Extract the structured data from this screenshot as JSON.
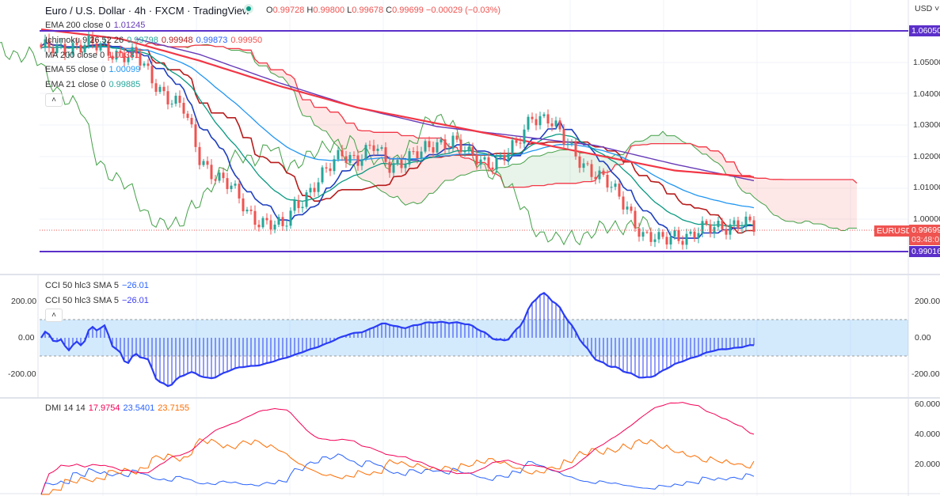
{
  "header": {
    "title": "Euro / U.S. Dollar · 4h · FXCM · TradingView",
    "open_label": "O",
    "open": "0.99728",
    "high_label": "H",
    "high": "0.99800",
    "low_label": "L",
    "low": "0.99678",
    "close_label": "C",
    "close": "0.99699",
    "change": "−0.00029 (−0.03%)",
    "currency": "USD"
  },
  "indicators": {
    "ema200": {
      "name": "EMA 200 close 0",
      "value": "1.01245",
      "color": "#673ab7"
    },
    "ichimoku": {
      "name": "Ichimoku 9 26 52 26",
      "v1": "0.99798",
      "v2": "0.99948",
      "v3": "0.99873",
      "v4": "0.99950"
    },
    "ma200": {
      "name": "MA 200 close 0",
      "value": "1.01381",
      "color": "#f23645"
    },
    "ema55": {
      "name": "EMA 55 close 0",
      "value": "1.00099",
      "color": "#2196f3"
    },
    "ema21": {
      "name": "EMA 21 close 0",
      "value": "0.99885",
      "color": "#26a69a"
    }
  },
  "price_axis": {
    "ticks": [
      "1.05000",
      "1.04000",
      "1.03000",
      "1.02000",
      "1.01000",
      "1.00000"
    ],
    "top_line": "1.06050",
    "bottom_line": "0.99016",
    "last_price": "0.99699",
    "countdown": "03:48:0",
    "symbol_tag": "EURUSD"
  },
  "cci": {
    "legend1": {
      "name": "CCI 50 hlc3 SMA 5",
      "value": "−26.01"
    },
    "legend2": {
      "name": "CCI 50 hlc3 SMA 5",
      "value": "−26.01"
    },
    "ticks": [
      "200.00",
      "0.00",
      "-200.00"
    ]
  },
  "dmi": {
    "name": "DMI 14 14",
    "adx": "17.9754",
    "plus_di": "23.5401",
    "minus_di": "23.7155",
    "ticks": [
      "60.0000",
      "40.0000",
      "20.0000"
    ]
  },
  "colors": {
    "up": "#26a69a",
    "down": "#ef5350",
    "level_line": "#5b2fc9",
    "accent_red": "#ef5350"
  },
  "chart_data": {
    "type": "candlestick",
    "price_anchors": [
      [
        0,
        1.054
      ],
      [
        8,
        1.056
      ],
      [
        16,
        1.055
      ],
      [
        24,
        1.052
      ],
      [
        28,
        1.045
      ],
      [
        32,
        1.04
      ],
      [
        36,
        1.035
      ],
      [
        40,
        1.02
      ],
      [
        44,
        1.015
      ],
      [
        48,
        1.01
      ],
      [
        52,
        1.003
      ],
      [
        56,
        1.0
      ],
      [
        61,
        0.997
      ],
      [
        64,
        1.005
      ],
      [
        68,
        1.01
      ],
      [
        72,
        1.015
      ],
      [
        76,
        1.022
      ],
      [
        80,
        1.02
      ],
      [
        84,
        1.023
      ],
      [
        88,
        1.018
      ],
      [
        92,
        1.02
      ],
      [
        96,
        1.021
      ],
      [
        100,
        1.025
      ],
      [
        104,
        1.026
      ],
      [
        108,
        1.02
      ],
      [
        112,
        1.019
      ],
      [
        116,
        1.02
      ],
      [
        120,
        1.023
      ],
      [
        124,
        1.034
      ],
      [
        128,
        1.033
      ],
      [
        132,
        1.025
      ],
      [
        136,
        1.02
      ],
      [
        140,
        1.015
      ],
      [
        144,
        1.01
      ],
      [
        148,
        1.005
      ],
      [
        152,
        0.995
      ],
      [
        156,
        0.993
      ],
      [
        160,
        0.996
      ],
      [
        164,
        0.995
      ],
      [
        168,
        0.997
      ],
      [
        172,
        0.999
      ],
      [
        176,
        0.999
      ],
      [
        181,
        0.997
      ]
    ],
    "ema200_anchors": [
      [
        24,
        1.058
      ],
      [
        40,
        1.053
      ],
      [
        60,
        1.044
      ],
      [
        80,
        1.036
      ],
      [
        100,
        1.03
      ],
      [
        120,
        1.027
      ],
      [
        140,
        1.024
      ],
      [
        160,
        1.018
      ],
      [
        181,
        1.0125
      ]
    ],
    "ma200_anchors": [
      [
        0,
        1.061
      ],
      [
        20,
        1.058
      ],
      [
        40,
        1.051
      ],
      [
        60,
        1.043
      ],
      [
        80,
        1.036
      ],
      [
        100,
        1.031
      ],
      [
        120,
        1.026
      ],
      [
        140,
        1.021
      ],
      [
        160,
        1.016
      ],
      [
        181,
        1.0138
      ]
    ]
  }
}
